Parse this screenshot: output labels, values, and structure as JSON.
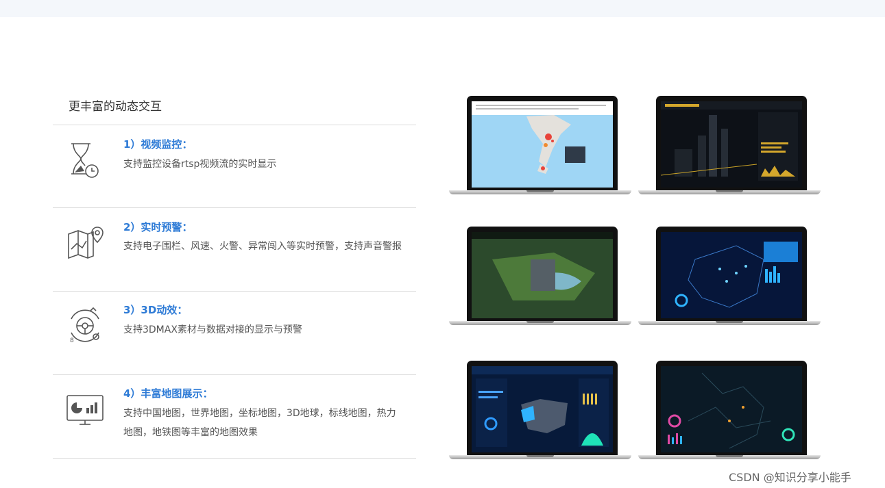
{
  "section_title": "更丰富的动态交互",
  "features": [
    {
      "title": "1）视频监控：",
      "desc": "支持监控设备rtsp视频流的实时显示",
      "icon": "hourglass-clock-icon"
    },
    {
      "title": "2）实时预警：",
      "desc": "支持电子围栏、风速、火警、异常闯入等实时预警，支持声音警报",
      "icon": "map-pin-icon"
    },
    {
      "title": "3）3D动效：",
      "desc": "支持3DMAX素材与数据对接的显示与预警",
      "icon": "3d-steering-icon"
    },
    {
      "title": "4）丰富地图展示：",
      "desc": "支持中国地图，世界地图，坐标地图，3D地球，标线地图，热力地图，地铁图等丰富的地图效果",
      "icon": "monitor-chart-icon"
    }
  ],
  "screens": [
    {
      "name": "island-map-screen"
    },
    {
      "name": "city-3d-dashboard-screen"
    },
    {
      "name": "park-aerial-screen"
    },
    {
      "name": "china-network-map-screen"
    },
    {
      "name": "china-data-dashboard-screen"
    },
    {
      "name": "dark-city-map-screen"
    }
  ],
  "watermark": "CSDN @知识分享小能手",
  "colors": {
    "accent": "#2e7bd6",
    "text": "#555555",
    "title": "#333333",
    "divider": "#dcdcdc"
  }
}
